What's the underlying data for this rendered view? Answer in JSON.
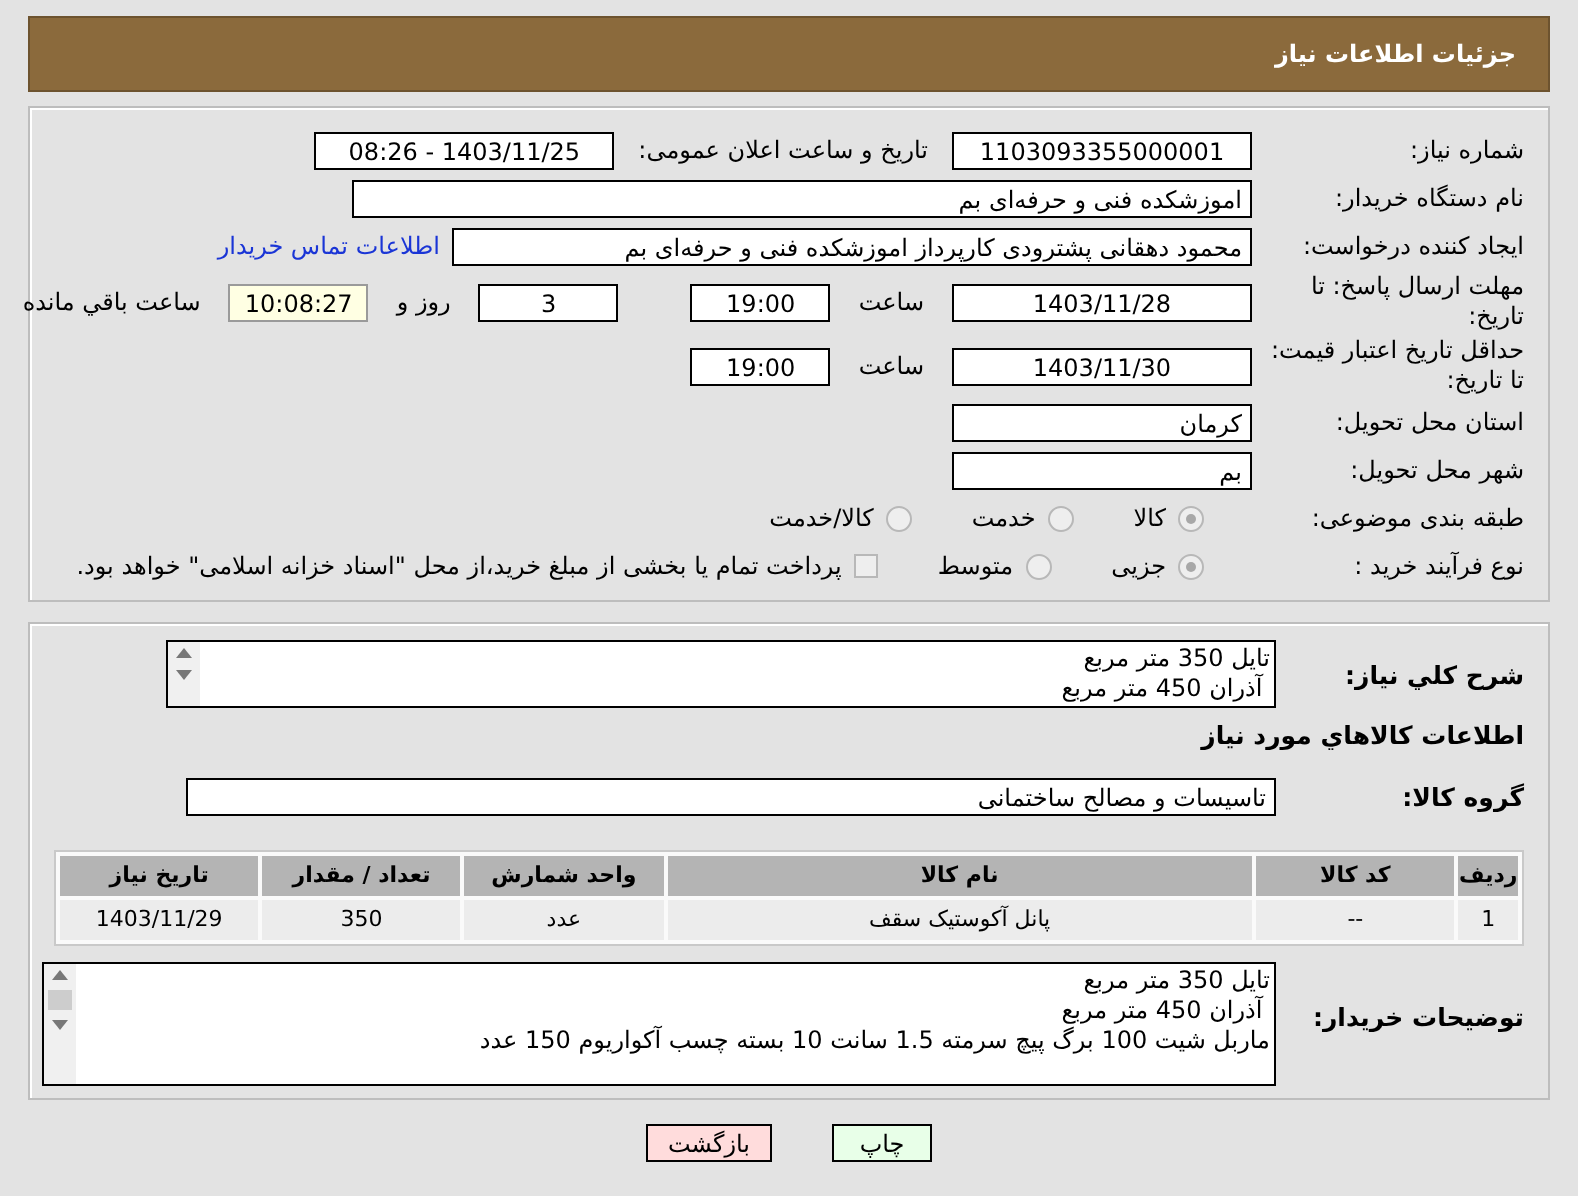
{
  "header": {
    "title": "جزئیات اطلاعات نیاز"
  },
  "need_number": {
    "label": "شماره نیاز:",
    "value": "1103093355000001"
  },
  "announce": {
    "label": "تاریخ و ساعت اعلان عمومی:",
    "value": "1403/11/25 - 08:26"
  },
  "buyer": {
    "label": "نام دستگاه خریدار:",
    "value": "اموزشکده فنی و حرفه‌ای بم"
  },
  "requester": {
    "label": "ایجاد کننده درخواست:",
    "value": "محمود دهقانی پشترودی کارپرداز اموزشکده فنی و حرفه‌ای بم",
    "link": "اطلاعات تماس خریدار"
  },
  "reply_deadline": {
    "label": "مهلت ارسال پاسخ: تا تاریخ:",
    "date": "1403/11/28",
    "time_label": "ساعت",
    "time": "19:00",
    "days": "3",
    "days_label": "روز و",
    "remaining": "10:08:27",
    "remaining_label": "ساعت باقي مانده"
  },
  "price_validity": {
    "label": "حداقل تاریخ اعتبار قیمت: تا تاریخ:",
    "date": "1403/11/30",
    "time_label": "ساعت",
    "time": "19:00"
  },
  "province": {
    "label": "استان محل تحویل:",
    "value": "کرمان"
  },
  "city": {
    "label": "شهر محل تحویل:",
    "value": "بم"
  },
  "category": {
    "label": "طبقه بندی موضوعی:",
    "options": [
      {
        "label": "کالا",
        "selected": true
      },
      {
        "label": "خدمت",
        "selected": false
      },
      {
        "label": "کالا/خدمت",
        "selected": false
      }
    ]
  },
  "purchase_process": {
    "label": "نوع فرآیند خرید :",
    "options": [
      {
        "label": "جزیی",
        "selected": true
      },
      {
        "label": "متوسط",
        "selected": false
      }
    ],
    "checkbox": {
      "label": "پرداخت تمام یا بخشی از مبلغ خرید،از محل \"اسناد خزانه اسلامی\" خواهد بود.",
      "checked": false
    }
  },
  "description": {
    "label": "شرح کلي نياز:",
    "lines": [
      "تایل 350 متر مربع",
      " آذران 450 متر مربع"
    ]
  },
  "items_heading": "اطلاعات کالاهاي مورد نياز",
  "goods_group": {
    "label": "گروه کالا:",
    "value": "تاسیسات و مصالح ساختمانی"
  },
  "table": {
    "columns": [
      "ردیف",
      "کد کالا",
      "نام کالا",
      "واحد شمارش",
      "تعداد / مقدار",
      "تاریخ نیاز"
    ],
    "rows": [
      [
        "1",
        "--",
        "پانل آکوستیک سقف",
        "عدد",
        "350",
        "1403/11/29"
      ]
    ]
  },
  "buyer_notes": {
    "label": "توضیحات خریدار:",
    "lines": [
      "تایل 350 متر مربع",
      " آذران 450 متر مربع",
      "ماربل شیت 100 برگ پیچ سرمته 1.5 سانت 10 بسته چسب آکواریوم 150 عدد"
    ]
  },
  "buttons": [
    {
      "label": "چاپ",
      "kind": "print"
    },
    {
      "label": "بازگشت",
      "kind": "back"
    }
  ]
}
